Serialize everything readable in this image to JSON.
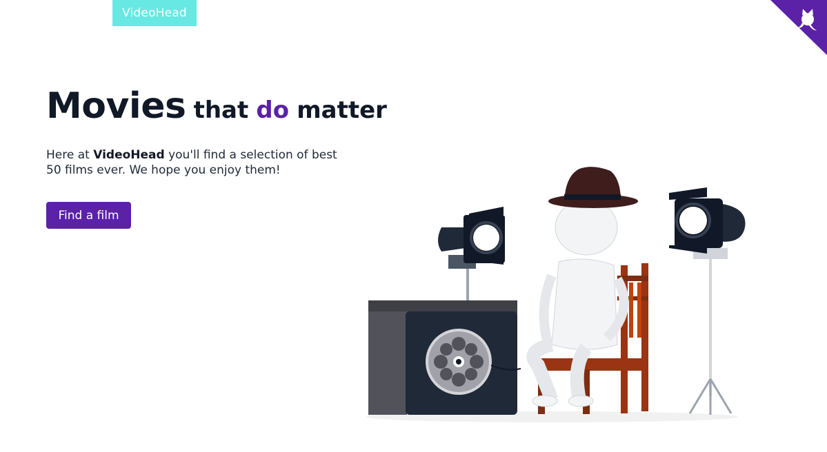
{
  "nav": {
    "brand": "VideoHead"
  },
  "hero": {
    "headline_big": "Movies",
    "headline_part1": "that",
    "headline_accent": "do",
    "headline_part2": "matter",
    "intro_prefix": "Here at ",
    "intro_brand": "VideoHead",
    "intro_suffix": " you'll find a selection of best 50 films ever. We hope you enjoy them!",
    "cta_label": "Find a film"
  },
  "icons": {
    "corner": "github-octocat-icon",
    "illustration": "film-director-illustration"
  },
  "colors": {
    "brand_bg": "#67e8e3",
    "accent": "#5b21a6",
    "text": "#111827"
  }
}
